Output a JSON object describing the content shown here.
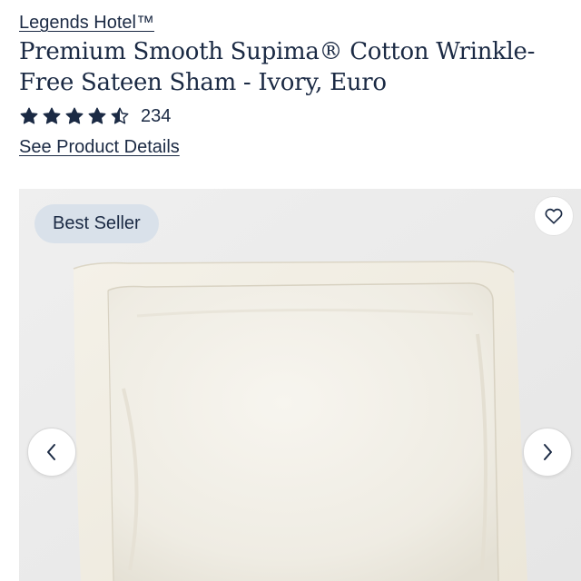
{
  "product": {
    "brand": "Legends Hotel™",
    "title": "Premium Smooth Supima® Cotton Wrinkle-Free Sateen Sham - Ivory, Euro",
    "rating": 4.5,
    "rating_max": 5,
    "review_count": "234",
    "details_link": "See Product Details"
  },
  "gallery": {
    "badge": "Best Seller",
    "icons": {
      "wishlist": "heart-icon",
      "prev": "chevron-left-icon",
      "next": "chevron-right-icon"
    }
  },
  "colors": {
    "text_primary": "#1b2a44",
    "badge_background": "#d9e1ea",
    "star": "#1b2a44",
    "image_background": "#ececec",
    "sham": "#f3f0e8"
  }
}
